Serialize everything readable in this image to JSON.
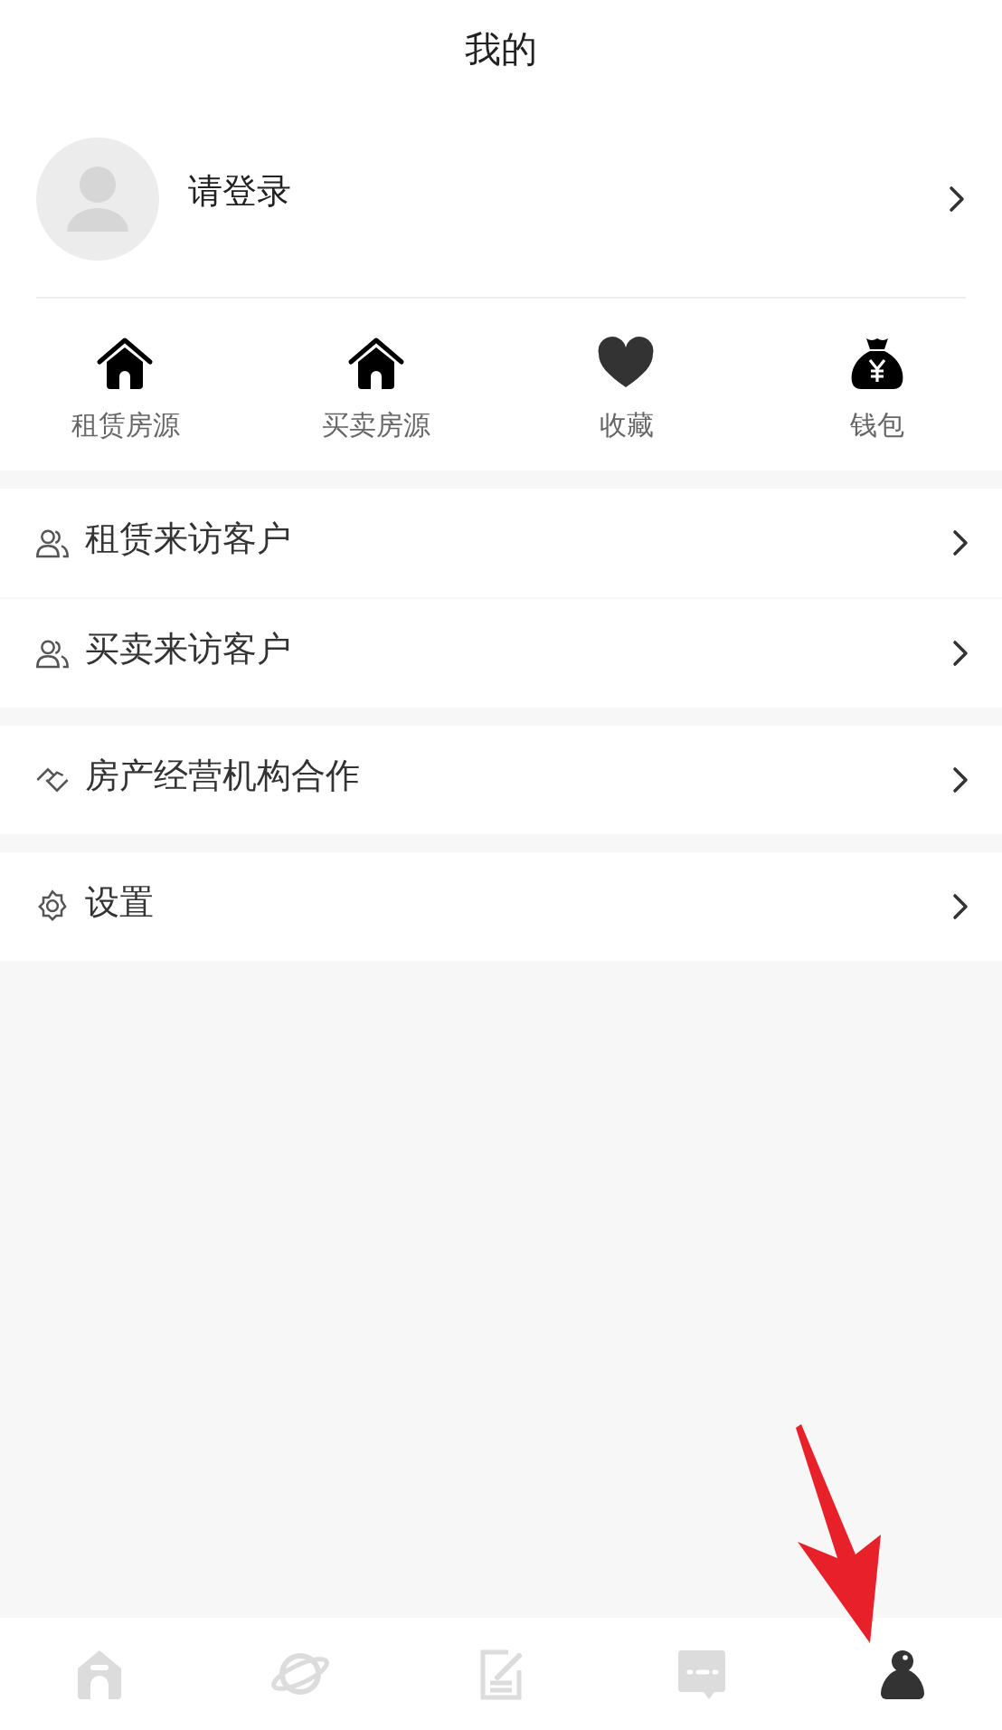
{
  "header": {
    "title": "我的"
  },
  "login": {
    "label": "请登录"
  },
  "shortcuts": [
    {
      "kind": "house",
      "label": "租赁房源"
    },
    {
      "kind": "house",
      "label": "买卖房源"
    },
    {
      "kind": "heart",
      "label": "收藏"
    },
    {
      "kind": "moneybag",
      "label": "钱包"
    }
  ],
  "menu_groups": [
    [
      {
        "kind": "people",
        "label": "租赁来访客户"
      },
      {
        "kind": "people",
        "label": "买卖来访客户"
      }
    ],
    [
      {
        "kind": "handshake",
        "label": "房产经营机构合作"
      }
    ],
    [
      {
        "kind": "gear",
        "label": "设置"
      }
    ]
  ],
  "tab_bar": [
    {
      "kind": "home",
      "selected": false
    },
    {
      "kind": "planet",
      "selected": false
    },
    {
      "kind": "note",
      "selected": false
    },
    {
      "kind": "chat",
      "selected": false
    },
    {
      "kind": "person",
      "selected": true
    }
  ],
  "annotation": {
    "kind": "arrow"
  }
}
